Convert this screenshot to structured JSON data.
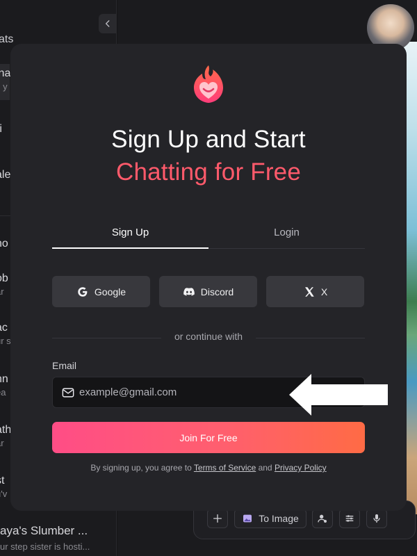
{
  "sidebar": {
    "heading": "ats",
    "items": [
      {
        "title": "ina",
        "subtitle": "s y"
      },
      {
        "title": "ri",
        "subtitle": ""
      },
      {
        "title": "ale",
        "subtitle": ""
      },
      {
        "title": "no",
        "subtitle": ""
      },
      {
        "title": "ob",
        "subtitle": "ar"
      },
      {
        "title": "ac",
        "subtitle": "ur s"
      },
      {
        "title": "nn",
        "subtitle": "ea"
      },
      {
        "title": "ath",
        "subtitle": "ar"
      },
      {
        "title": "st",
        "subtitle": "u'v"
      }
    ],
    "last_item": {
      "title": "aya's Slumber ...",
      "subtitle": "ur step sister is hosti..."
    }
  },
  "composer": {
    "to_image_label": "To Image"
  },
  "modal": {
    "title_line1": "Sign Up and Start",
    "title_line2": "Chatting for Free",
    "tabs": {
      "signup": "Sign Up",
      "login": "Login"
    },
    "social": {
      "google": "Google",
      "discord": "Discord",
      "x": "X"
    },
    "divider": "or continue with",
    "email": {
      "label": "Email",
      "placeholder": "example@gmail.com",
      "value": ""
    },
    "join_label": "Join For Free",
    "legal": {
      "prefix": "By signing up, you agree to ",
      "terms": "Terms of Service",
      "and": " and ",
      "privacy": "Privacy Policy"
    }
  },
  "colors": {
    "accent_pink": "#ff4d86",
    "accent_orange": "#ff6b45",
    "title_accent": "#ff5a6b",
    "modal_bg": "#242428"
  },
  "icons": [
    "chevron-left-icon",
    "flame-heart-logo",
    "google-icon",
    "discord-icon",
    "x-icon",
    "mail-icon",
    "plus-icon",
    "image-icon",
    "user-settings-icon",
    "sliders-icon",
    "mic-icon",
    "arrow-left-icon"
  ]
}
